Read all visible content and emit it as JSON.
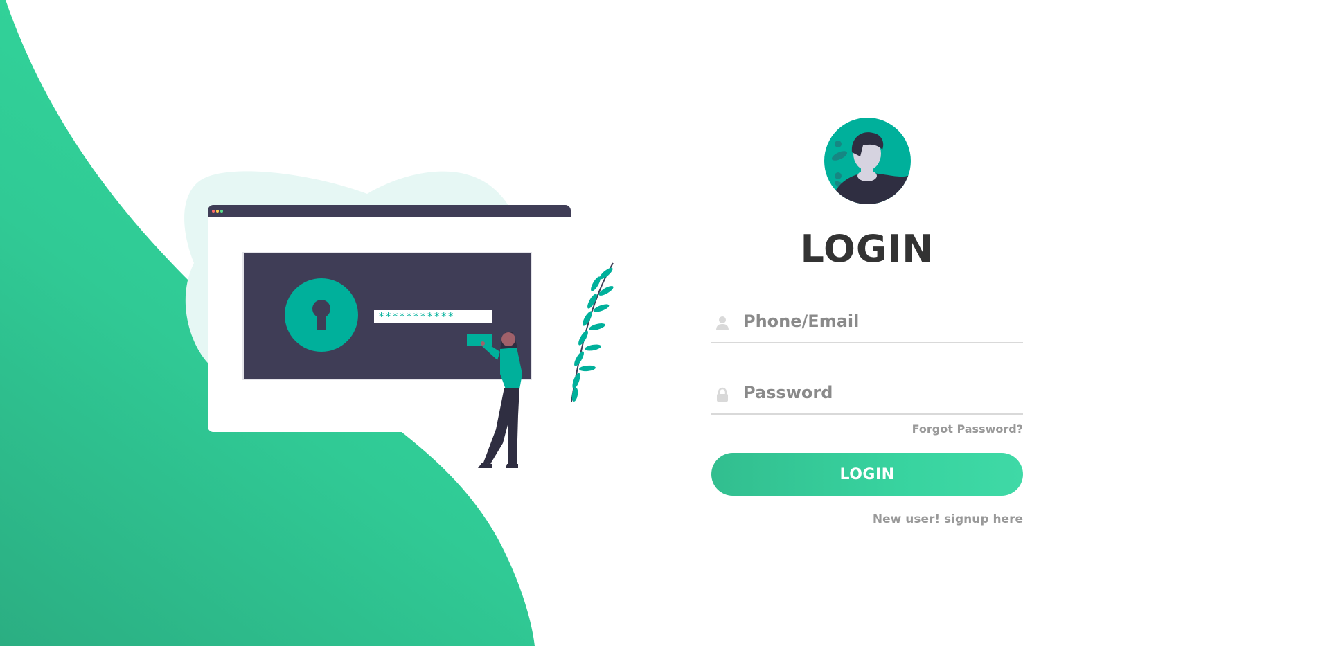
{
  "colors": {
    "brand": "#38d39f",
    "brand_dark": "#32be8f",
    "accent": "#00b09b",
    "ink": "#3f3d56",
    "text_dark": "#333333",
    "text_muted": "#999999"
  },
  "illustration": {
    "masked_password": "***********"
  },
  "login": {
    "title": "LOGIN",
    "email_field": {
      "label": "Phone/Email",
      "icon": "user-icon"
    },
    "password_field": {
      "label": "Password",
      "icon": "lock-icon"
    },
    "forgot_link": "Forgot Password?",
    "submit_label": "LOGIN",
    "signup_link": "New user! signup here"
  }
}
